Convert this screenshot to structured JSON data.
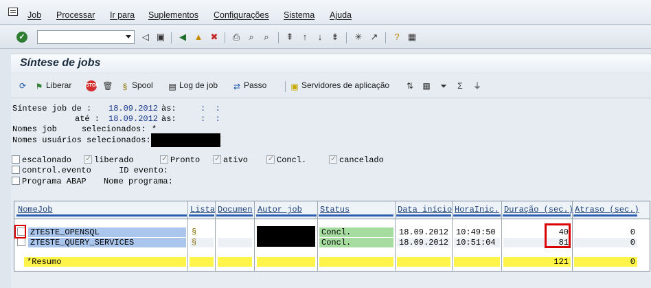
{
  "menu": {
    "items": [
      "Job",
      "Processar",
      "Ir para",
      "Suplementos",
      "Configurações",
      "Sistema",
      "Ajuda"
    ]
  },
  "toolbar": {
    "command_value": ""
  },
  "title": "Síntese de jobs",
  "app_toolbar": {
    "liberar": "Liberar",
    "spool": "Spool",
    "log": "Log de job",
    "passo": "Passo",
    "servidores": "Servidores de aplicação"
  },
  "selection": {
    "line1_label": "Síntese job de :",
    "date_from": "18.09.2012",
    "time_label1": "às:",
    "time_from": ":  :",
    "line2_label": "até :",
    "date_to": "18.09.2012",
    "time_label2": "às:",
    "time_to": ":  :",
    "line3_label": "Nomes job     selecionados:",
    "job_names": "*",
    "line4_label": "Nomes usuários selecionados:"
  },
  "status_filters": [
    {
      "label": "escalonado",
      "checked": false
    },
    {
      "label": "liberado",
      "checked": true
    },
    {
      "label": "Pronto",
      "checked": true
    },
    {
      "label": "ativo",
      "checked": true
    },
    {
      "label": "Concl.",
      "checked": true
    },
    {
      "label": "cancelado",
      "checked": true
    },
    {
      "label": "control.evento",
      "checked": false
    },
    {
      "label": "Programa ABAP",
      "checked": false
    }
  ],
  "event_label": "ID evento:",
  "program_label": "Nome programa:",
  "table": {
    "headers": [
      "NomeJob",
      "Lista",
      "Documen",
      "Autor job",
      "Status",
      "Data início",
      "HoraInic.",
      "Duração (sec.)",
      "Atraso (sec.)"
    ],
    "rows": [
      {
        "job": "ZTESTE_OPENSQL",
        "status": "Concl.",
        "date": "18.09.2012",
        "time": "10:49:50",
        "duration": "40",
        "delay": "0"
      },
      {
        "job": "ZTESTE_QUERY_SERVICES",
        "status": "Concl.",
        "date": "18.09.2012",
        "time": "10:51:04",
        "duration": "81",
        "delay": "0"
      }
    ],
    "summary": {
      "label": "*Resumo",
      "duration": "121",
      "delay": "0"
    }
  },
  "colors": {
    "job_cell": "#aac6ec",
    "status_cell": "#a6dca0",
    "summary_row": "#fff44a",
    "highlight_box": "#d90000"
  }
}
